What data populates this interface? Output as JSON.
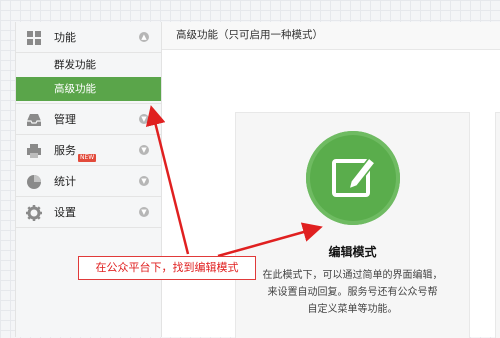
{
  "sidebar": {
    "sections": [
      {
        "label": "功能",
        "icon": "grid-icon"
      },
      {
        "label": "管理",
        "icon": "inbox-icon"
      },
      {
        "label": "服务",
        "icon": "printer-icon",
        "badge": "NEW"
      },
      {
        "label": "统计",
        "icon": "pie-chart-icon"
      },
      {
        "label": "设置",
        "icon": "gear-icon"
      }
    ],
    "sub_items": [
      "群发功能",
      "高级功能"
    ],
    "active_sub_item": "高级功能"
  },
  "main": {
    "header": "高级功能（只可启用一种模式）",
    "card": {
      "title": "编辑模式",
      "description": [
        "在此模式下，可以通过简单的界面编辑，",
        "来设置自动回复。服务号还有公众号帮",
        "自定义菜单等功能。"
      ]
    }
  },
  "annotation": {
    "callout_text": "在公众平台下，找到编辑模式",
    "color": "#e02020"
  },
  "colors": {
    "accent_green": "#5aa54a",
    "badge_red": "#e24a3b"
  }
}
